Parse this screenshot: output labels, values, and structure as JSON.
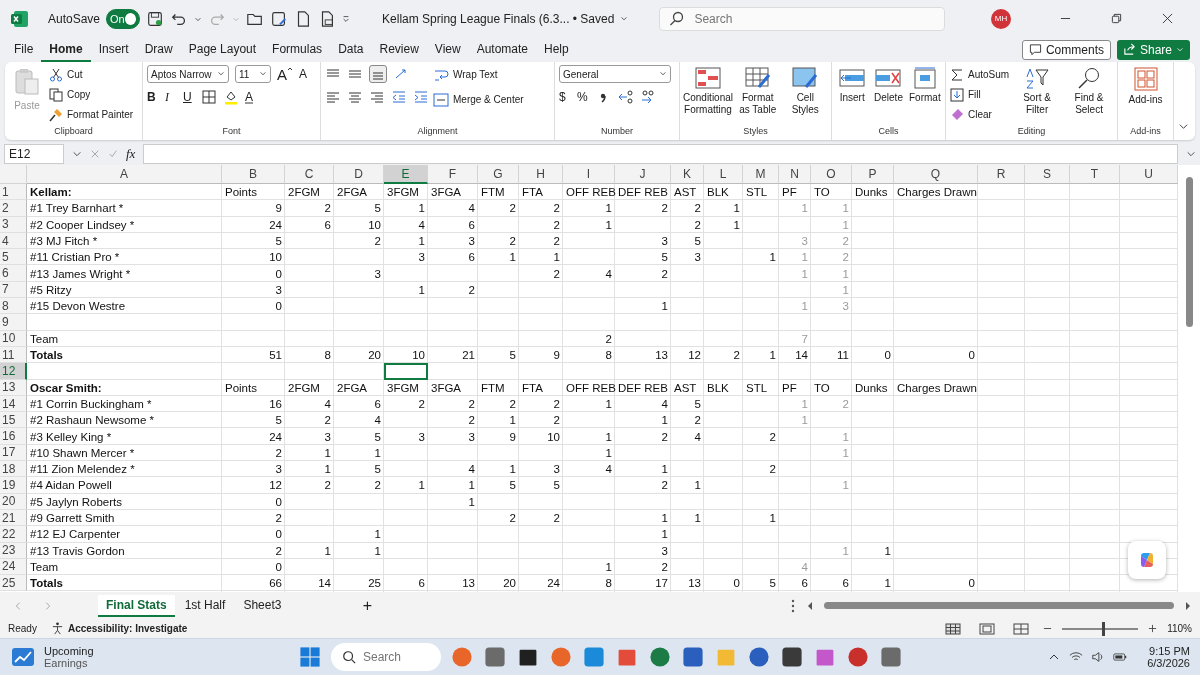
{
  "title_bar": {
    "autosave": {
      "label": "AutoSave",
      "state": "On",
      "on": true
    },
    "title": "Kellam Spring League Finals (6.3... • Saved",
    "search": {
      "placeholder": "Search"
    },
    "avatar": "MH"
  },
  "menu_tabs": [
    {
      "label": "File",
      "selected": false
    },
    {
      "label": "Home",
      "selected": true
    },
    {
      "label": "Insert",
      "selected": false
    },
    {
      "label": "Draw",
      "selected": false
    },
    {
      "label": "Page Layout",
      "selected": false
    },
    {
      "label": "Formulas",
      "selected": false
    },
    {
      "label": "Data",
      "selected": false
    },
    {
      "label": "Review",
      "selected": false
    },
    {
      "label": "View",
      "selected": false
    },
    {
      "label": "Automate",
      "selected": false
    },
    {
      "label": "Help",
      "selected": false
    }
  ],
  "header_buttons": {
    "comments": "Comments",
    "share": "Share"
  },
  "ribbon": {
    "clipboard": {
      "label": "Clipboard",
      "paste": "Paste",
      "cut": "Cut",
      "copy": "Copy",
      "format_painter": "Format Painter"
    },
    "font": {
      "label": "Font",
      "family": "Aptos Narrow",
      "size": "11",
      "grow": "A",
      "shrink": "A",
      "bold": "B",
      "italic": "I",
      "underline": "U",
      "font_color_label": "A"
    },
    "alignment": {
      "label": "Alignment",
      "wrap_text": "Wrap Text",
      "merge_center": "Merge & Center"
    },
    "number": {
      "label": "Number",
      "format": "General",
      "currency": "$",
      "percent": "%"
    },
    "styles": {
      "label": "Styles",
      "conditional": "Conditional Formatting",
      "table": "Format as Table",
      "cell_styles": "Cell Styles"
    },
    "cells": {
      "label": "Cells",
      "insert": "Insert",
      "delete": "Delete",
      "format": "Format"
    },
    "editing": {
      "label": "Editing",
      "autosum": "AutoSum",
      "fill": "Fill",
      "clear": "Clear",
      "sort": "Sort & Filter",
      "find": "Find & Select"
    },
    "addins": {
      "label": "Add-ins",
      "button": "Add-ins"
    }
  },
  "formula_bar": {
    "name_box": "E12",
    "function_label": "fx"
  },
  "columns": [
    {
      "letter": "A",
      "selected": false
    },
    {
      "letter": "B",
      "selected": false
    },
    {
      "letter": "C",
      "selected": false
    },
    {
      "letter": "D",
      "selected": false
    },
    {
      "letter": "E",
      "selected": true
    },
    {
      "letter": "F",
      "selected": false
    },
    {
      "letter": "G",
      "selected": false
    },
    {
      "letter": "H",
      "selected": false
    },
    {
      "letter": "I",
      "selected": false
    },
    {
      "letter": "J",
      "selected": false
    },
    {
      "letter": "K",
      "selected": false
    },
    {
      "letter": "L",
      "selected": false
    },
    {
      "letter": "M",
      "selected": false
    },
    {
      "letter": "N",
      "selected": false
    },
    {
      "letter": "O",
      "selected": false
    },
    {
      "letter": "P",
      "selected": false
    },
    {
      "letter": "Q",
      "selected": false
    },
    {
      "letter": "R",
      "selected": false
    },
    {
      "letter": "S",
      "selected": false
    },
    {
      "letter": "T",
      "selected": false
    },
    {
      "letter": "U",
      "selected": false
    }
  ],
  "rows": [
    {
      "number": "1",
      "kind": "header",
      "selected": false,
      "cells": [
        "Kellam:",
        "Points",
        "2FGM",
        "2FGA",
        "3FGM",
        "3FGA",
        "FTM",
        "FTA",
        "OFF REB",
        "DEF REB",
        "AST",
        "BLK",
        "STL",
        "PF",
        "TO",
        "Dunks",
        "Charges Drawn"
      ]
    },
    {
      "number": "2",
      "kind": "player",
      "selected": false,
      "cells": [
        "#1 Trey Barnhart *",
        "9",
        "2",
        "5",
        "1",
        "4",
        "2",
        "2",
        "1",
        "2",
        "2",
        "1",
        null,
        {
          "v": "1",
          "faint": true
        },
        {
          "v": "1",
          "faint": true
        }
      ]
    },
    {
      "number": "3",
      "kind": "player",
      "selected": false,
      "cells": [
        "#2 Cooper Lindsey *",
        "24",
        "6",
        "10",
        "4",
        "6",
        null,
        "2",
        "1",
        null,
        "2",
        "1",
        null,
        null,
        {
          "v": "1",
          "faint": true
        }
      ]
    },
    {
      "number": "4",
      "kind": "player",
      "selected": false,
      "cells": [
        "#3 MJ Fitch *",
        "5",
        null,
        "2",
        "1",
        "3",
        "2",
        "2",
        null,
        "3",
        "5",
        null,
        null,
        {
          "v": "3",
          "faint": true
        },
        {
          "v": "2",
          "faint": true
        }
      ]
    },
    {
      "number": "5",
      "kind": "player",
      "selected": false,
      "cells": [
        "#11 Cristian Pro *",
        "10",
        null,
        null,
        "3",
        "6",
        "1",
        "1",
        null,
        "5",
        "3",
        null,
        "1",
        {
          "v": "1",
          "faint": true
        },
        {
          "v": "2",
          "faint": true
        }
      ]
    },
    {
      "number": "6",
      "kind": "player",
      "selected": false,
      "cells": [
        "#13 James Wright *",
        "0",
        null,
        "3",
        null,
        null,
        null,
        "2",
        "4",
        "2",
        null,
        null,
        null,
        {
          "v": "1",
          "faint": true
        },
        {
          "v": "1",
          "faint": true
        }
      ]
    },
    {
      "number": "7",
      "kind": "player",
      "selected": false,
      "cells": [
        "#5 Ritzy",
        "3",
        null,
        null,
        "1",
        "2",
        null,
        null,
        null,
        null,
        null,
        null,
        null,
        null,
        {
          "v": "1",
          "faint": true
        }
      ]
    },
    {
      "number": "8",
      "kind": "player",
      "selected": false,
      "cells": [
        "#15 Devon Westre",
        "0",
        null,
        null,
        null,
        null,
        null,
        null,
        null,
        "1",
        null,
        null,
        null,
        {
          "v": "1",
          "faint": true
        },
        {
          "v": "3",
          "faint": true
        }
      ]
    },
    {
      "number": "9",
      "selected": false
    },
    {
      "number": "10",
      "kind": "team",
      "selected": false,
      "cells": [
        "Team",
        null,
        null,
        null,
        null,
        null,
        null,
        null,
        "2",
        null,
        null,
        null,
        null,
        {
          "v": "7",
          "faint": true
        }
      ]
    },
    {
      "number": "11",
      "kind": "total",
      "selected": false,
      "cells": [
        "Totals",
        "51",
        "8",
        "20",
        "10",
        "21",
        "5",
        "9",
        "8",
        "13",
        "12",
        "2",
        "1",
        "14",
        "11",
        "0",
        "0"
      ]
    },
    {
      "number": "12",
      "selected": true
    },
    {
      "number": "13",
      "kind": "header",
      "selected": false,
      "cells": [
        "Oscar Smith:",
        "Points",
        "2FGM",
        "2FGA",
        "3FGM",
        "3FGA",
        "FTM",
        "FTA",
        "OFF REB",
        "DEF REB",
        "AST",
        "BLK",
        "STL",
        "PF",
        "TO",
        "Dunks",
        "Charges Drawn"
      ]
    },
    {
      "number": "14",
      "kind": "player",
      "selected": false,
      "cells": [
        "#1 Corrin Buckingham *",
        "16",
        "4",
        "6",
        "2",
        "2",
        "2",
        "2",
        "1",
        "4",
        "5",
        null,
        null,
        {
          "v": "1",
          "faint": true
        },
        {
          "v": "2",
          "faint": true
        }
      ]
    },
    {
      "number": "15",
      "kind": "player",
      "selected": false,
      "cells": [
        "#2 Rashaun Newsome *",
        "5",
        "2",
        "4",
        null,
        "2",
        "1",
        "2",
        null,
        "1",
        "2",
        null,
        null,
        {
          "v": "1",
          "faint": true
        }
      ]
    },
    {
      "number": "16",
      "kind": "player",
      "selected": false,
      "cells": [
        "#3 Kelley King *",
        "24",
        "3",
        "5",
        "3",
        "3",
        "9",
        "10",
        "1",
        "2",
        "4",
        null,
        "2",
        null,
        {
          "v": "1",
          "faint": true
        }
      ]
    },
    {
      "number": "17",
      "kind": "player",
      "selected": false,
      "cells": [
        "#10 Shawn Mercer *",
        "2",
        "1",
        "1",
        null,
        null,
        null,
        null,
        "1",
        null,
        null,
        null,
        null,
        null,
        {
          "v": "1",
          "faint": true
        }
      ]
    },
    {
      "number": "18",
      "kind": "player",
      "selected": false,
      "cells": [
        "#11 Zion Melendez *",
        "3",
        "1",
        "5",
        null,
        "4",
        "1",
        "3",
        "4",
        "1",
        null,
        null,
        "2"
      ]
    },
    {
      "number": "19",
      "kind": "player",
      "selected": false,
      "cells": [
        "#4 Aidan Powell",
        "12",
        "2",
        "2",
        "1",
        "1",
        "5",
        "5",
        null,
        "2",
        "1",
        null,
        null,
        null,
        {
          "v": "1",
          "faint": true
        }
      ]
    },
    {
      "number": "20",
      "kind": "player",
      "selected": false,
      "cells": [
        "#5 Jaylyn Roberts",
        "0",
        null,
        null,
        null,
        "1"
      ]
    },
    {
      "number": "21",
      "kind": "player",
      "selected": false,
      "cells": [
        "#9 Garrett Smith",
        "2",
        null,
        null,
        null,
        null,
        "2",
        "2",
        null,
        "1",
        "1",
        null,
        "1"
      ]
    },
    {
      "number": "22",
      "kind": "player",
      "selected": false,
      "cells": [
        "#12 EJ Carpenter",
        "0",
        null,
        "1",
        null,
        null,
        null,
        null,
        null,
        "1"
      ]
    },
    {
      "number": "23",
      "kind": "player",
      "selected": false,
      "cells": [
        "#13 Travis Gordon",
        "2",
        "1",
        "1",
        null,
        null,
        null,
        null,
        null,
        "3",
        null,
        null,
        null,
        null,
        {
          "v": "1",
          "faint": true
        },
        "1"
      ]
    },
    {
      "number": "24",
      "kind": "team",
      "selected": false,
      "cells": [
        "Team",
        "0",
        null,
        null,
        null,
        null,
        null,
        null,
        "1",
        "2",
        null,
        null,
        null,
        {
          "v": "4",
          "faint": true
        }
      ]
    },
    {
      "number": "25",
      "kind": "total",
      "selected": false,
      "cells": [
        "Totals",
        "66",
        "14",
        "25",
        "6",
        "13",
        "20",
        "24",
        "8",
        "17",
        "13",
        "0",
        "5",
        "6",
        "6",
        "1",
        "0"
      ]
    }
  ],
  "sheet_tabs": [
    {
      "label": "Final Stats",
      "selected": true
    },
    {
      "label": "1st Half",
      "selected": false
    },
    {
      "label": "Sheet3",
      "selected": false
    }
  ],
  "add_sheet": "+",
  "status_bar": {
    "ready": "Ready",
    "accessibility": "Accessibility: Investigate",
    "zoom_slider": {
      "level": 0.55
    },
    "zoom": "110%"
  },
  "taskbar": {
    "weather": {
      "title": "Upcoming",
      "subtitle": "Earnings"
    },
    "search": {
      "placeholder": "Search"
    },
    "time": "9:15 PM",
    "date": "6/3/2026"
  }
}
